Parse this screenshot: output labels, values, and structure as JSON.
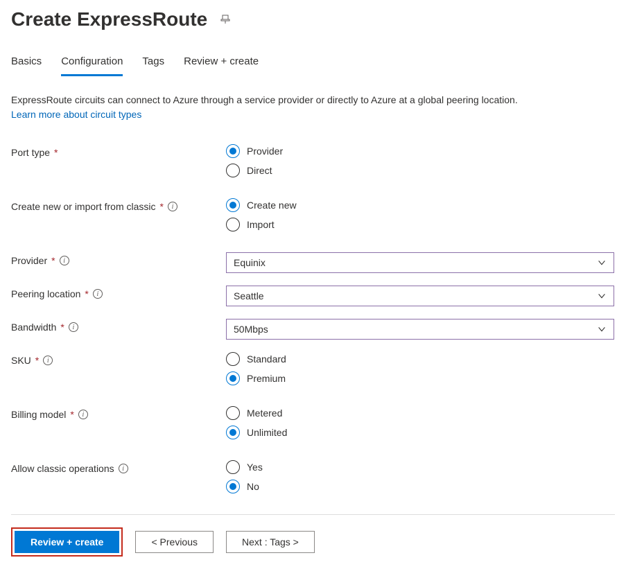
{
  "header": {
    "title": "Create ExpressRoute"
  },
  "tabs": {
    "basics": "Basics",
    "configuration": "Configuration",
    "tags": "Tags",
    "review": "Review + create"
  },
  "description": {
    "text": "ExpressRoute circuits can connect to Azure through a service provider or directly to Azure at a global peering location.",
    "link": "Learn more about circuit types"
  },
  "fields": {
    "portType": {
      "label": "Port type",
      "options": {
        "provider": "Provider",
        "direct": "Direct"
      }
    },
    "createImport": {
      "label": "Create new or import from classic",
      "options": {
        "create": "Create new",
        "import": "Import"
      }
    },
    "provider": {
      "label": "Provider",
      "value": "Equinix"
    },
    "peering": {
      "label": "Peering location",
      "value": "Seattle"
    },
    "bandwidth": {
      "label": "Bandwidth",
      "value": "50Mbps"
    },
    "sku": {
      "label": "SKU",
      "options": {
        "standard": "Standard",
        "premium": "Premium"
      }
    },
    "billing": {
      "label": "Billing model",
      "options": {
        "metered": "Metered",
        "unlimited": "Unlimited"
      }
    },
    "classic": {
      "label": "Allow classic operations",
      "options": {
        "yes": "Yes",
        "no": "No"
      }
    }
  },
  "footer": {
    "review": "Review + create",
    "previous": "< Previous",
    "next": "Next : Tags >"
  }
}
